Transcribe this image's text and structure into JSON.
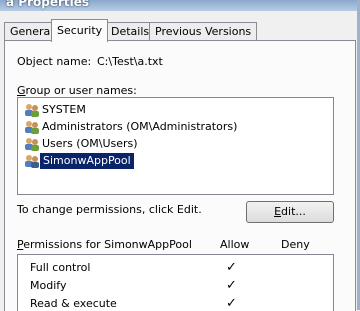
{
  "window": {
    "title": "a Properties"
  },
  "tabs": [
    {
      "label": "General"
    },
    {
      "label": "Security"
    },
    {
      "label": "Details"
    },
    {
      "label": "Previous Versions"
    }
  ],
  "object": {
    "label": "Object name:",
    "value": "C:\\Test\\a.txt"
  },
  "users": {
    "label": "Group or user names:",
    "items": [
      {
        "name": "SYSTEM",
        "icon": "users-icon"
      },
      {
        "name": "Administrators (OM\\Administrators)",
        "icon": "users-icon"
      },
      {
        "name": "Users (OM\\Users)",
        "icon": "users-icon"
      },
      {
        "name": "SimonwAppPool",
        "icon": "users-icon",
        "selected": true
      }
    ]
  },
  "change_hint": "To change permissions, click Edit.",
  "edit_button": "Edit...",
  "permissions": {
    "label": "Permissions for SimonwAppPool",
    "allow_header": "Allow",
    "deny_header": "Deny",
    "rows": [
      {
        "name": "Full control",
        "allow": "✓"
      },
      {
        "name": "Modify",
        "allow": "✓"
      },
      {
        "name": "Read & execute",
        "allow": "✓"
      }
    ]
  },
  "colors": {
    "selection": "#0a246a",
    "title_bar": "#8aa8cc"
  }
}
